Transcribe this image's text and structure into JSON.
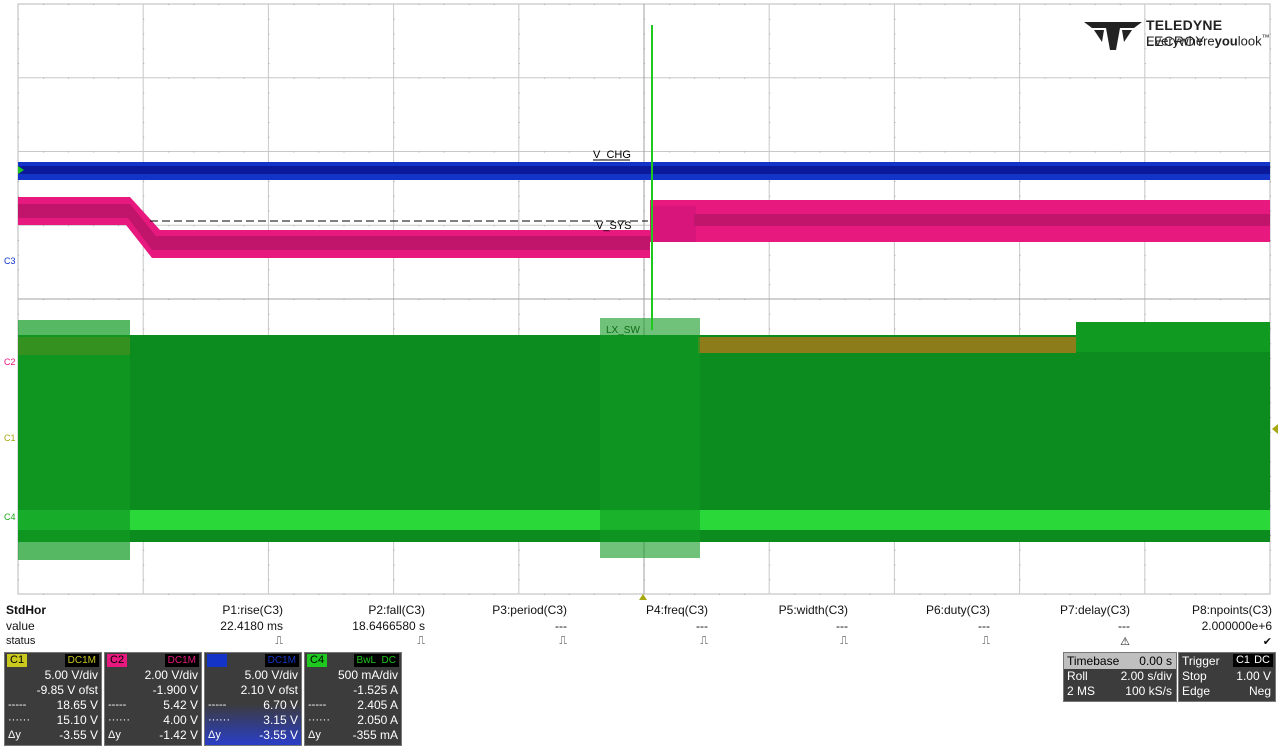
{
  "logo": {
    "brand": "TELEDYNE LECROY",
    "brand_bold": "TELEDYNE",
    "brand_light": "LECROY",
    "tagline_a": "Everywhere",
    "tagline_b": "you",
    "tagline_c": "look",
    "tm": "™"
  },
  "trace_labels": {
    "c3": "C3",
    "c2": "C2",
    "c1": "C1",
    "c4": "C4",
    "v_chg": "V_CHG",
    "v_sys": "V_SYS",
    "v_sw": "LX_SW"
  },
  "colors": {
    "c1": "#c8c81e",
    "c2": "#e8197e",
    "c3": "#1434c8",
    "c4": "#1ec81e",
    "grid": "#b8b8b8",
    "panel": "#3c3c3c"
  },
  "measurements": {
    "row_title": "StdHor",
    "row_value": "value",
    "row_status": "status",
    "params": [
      {
        "label": "P1:rise(C3)",
        "value": "22.4180 ms",
        "status": "⎍"
      },
      {
        "label": "P2:fall(C3)",
        "value": "18.6466580 s",
        "status": "⎍"
      },
      {
        "label": "P3:period(C3)",
        "value": "---",
        "status": "⎍"
      },
      {
        "label": "P4:freq(C3)",
        "value": "---",
        "status": "⎍"
      },
      {
        "label": "P5:width(C3)",
        "value": "---",
        "status": "⎍"
      },
      {
        "label": "P6:duty(C3)",
        "value": "---",
        "status": "⎍"
      },
      {
        "label": "P7:delay(C3)",
        "value": "---",
        "status": "⚠"
      },
      {
        "label": "P8:npoints(C3)",
        "value": "2.000000e+6",
        "status": "✔"
      }
    ]
  },
  "channels": [
    {
      "tag": "C1",
      "coupling": "DC1M",
      "scale": "5.00 V/div",
      "offset": "-9.85 V ofst",
      "cursor1": "18.65 V",
      "cursor2": "15.10 V",
      "delta_label": "Δy",
      "delta": "-3.55 V"
    },
    {
      "tag": "C2",
      "coupling": "DC1M",
      "scale": "2.00 V/div",
      "offset": "-1.900 V",
      "cursor1": "5.42 V",
      "cursor2": "4.00 V",
      "delta_label": "Δy",
      "delta": "-1.42 V"
    },
    {
      "tag": "C3",
      "coupling": "DC1M",
      "scale": "5.00 V/div",
      "offset": "2.10 V ofst",
      "cursor1": "6.70 V",
      "cursor2": "3.15 V",
      "delta_label": "Δy",
      "delta": "-3.55 V"
    },
    {
      "tag": "C4",
      "bwl": "BwL",
      "coupling": "DC",
      "scale": "500 mA/div",
      "offset": "-1.525 A",
      "cursor1": "2.405 A",
      "cursor2": "2.050 A",
      "delta_label": "Δy",
      "delta": "-355 mA"
    }
  ],
  "timebase": {
    "title": "Timebase",
    "delay": "0.00 s",
    "mode": "Roll",
    "rate": "2.00 s/div",
    "memory": "2 MS",
    "sample_rate": "100 kS/s"
  },
  "trigger": {
    "title": "Trigger",
    "source": "C1",
    "coupling": "DC",
    "state": "Stop",
    "level": "1.00 V",
    "type": "Edge",
    "slope": "Neg"
  }
}
